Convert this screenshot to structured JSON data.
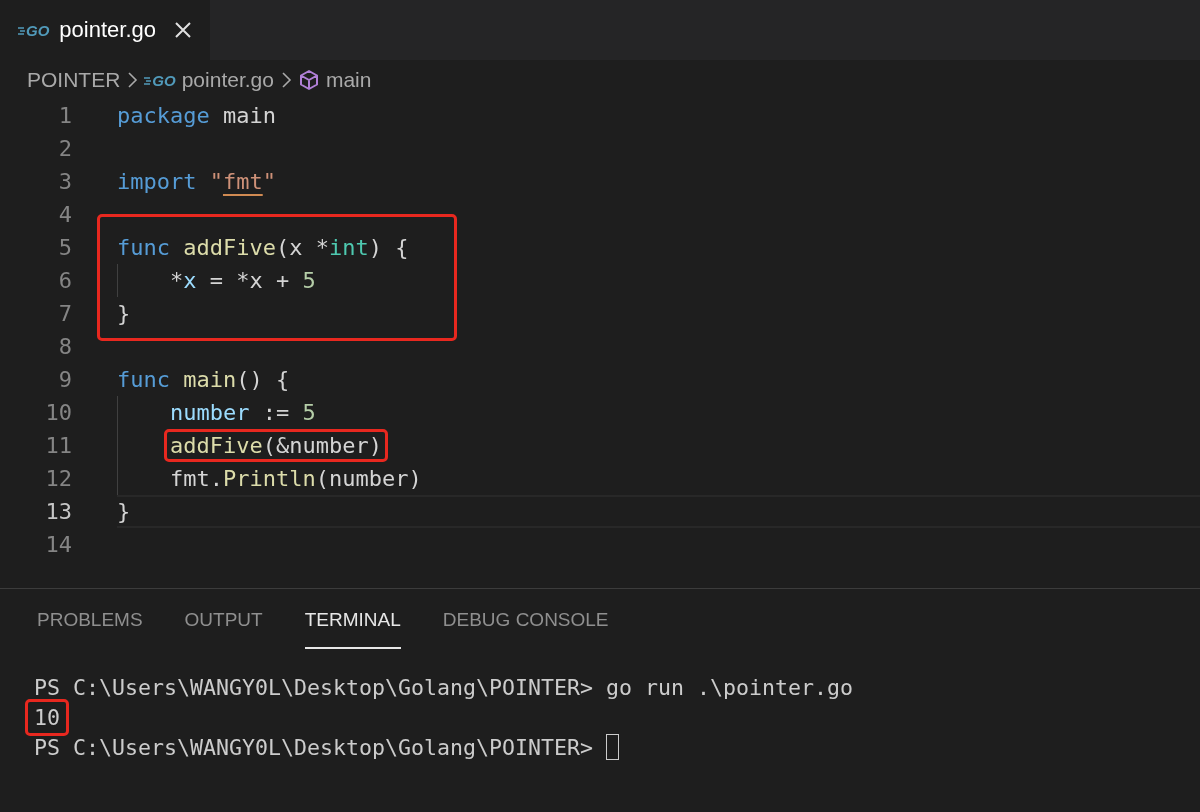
{
  "tabs": [
    {
      "icon_text": "GO",
      "label": "pointer.go",
      "selected": true
    }
  ],
  "breadcrumb": [
    {
      "kind": "folder",
      "label": "POINTER"
    },
    {
      "kind": "file",
      "icon_text": "GO",
      "label": "pointer.go"
    },
    {
      "kind": "symbol",
      "label": "main"
    }
  ],
  "code": [
    {
      "boxed": false,
      "lines": [
        {
          "number": "1",
          "current": false,
          "indented": false,
          "tokens": [
            {
              "kind": "keyword",
              "text": "package"
            },
            {
              "kind": "plain",
              "text": " main"
            }
          ]
        },
        {
          "number": "2",
          "current": false,
          "indented": false
        },
        {
          "number": "3",
          "current": false,
          "indented": false,
          "tokens": [
            {
              "kind": "keyword",
              "text": "import "
            },
            {
              "kind": "string",
              "text": "\""
            },
            {
              "kind": "string_warn",
              "text": "fmt"
            },
            {
              "kind": "string",
              "text": "\""
            }
          ]
        },
        {
          "number": "4",
          "current": false,
          "indented": false
        }
      ]
    },
    {
      "boxed": true,
      "lines": [
        {
          "number": "5",
          "current": false,
          "indented": false,
          "tokens": [
            {
              "kind": "keyword",
              "text": "func "
            },
            {
              "kind": "func",
              "text": "addFive"
            },
            {
              "kind": "plain",
              "text": "(x *"
            },
            {
              "kind": "type",
              "text": "int"
            },
            {
              "kind": "plain",
              "text": ") {"
            }
          ]
        },
        {
          "number": "6",
          "current": false,
          "indented": true,
          "tokens": [
            {
              "kind": "plain",
              "text": "*"
            },
            {
              "kind": "var",
              "text": "x"
            },
            {
              "kind": "plain",
              "text": " = *x + "
            },
            {
              "kind": "number",
              "text": "5"
            }
          ]
        },
        {
          "number": "7",
          "current": false,
          "indented": false,
          "tokens": [
            {
              "kind": "plain",
              "text": "}"
            }
          ]
        }
      ]
    },
    {
      "boxed": false,
      "lines": [
        {
          "number": "8",
          "current": false,
          "indented": false
        },
        {
          "number": "9",
          "current": false,
          "indented": false,
          "tokens": [
            {
              "kind": "keyword",
              "text": "func "
            },
            {
              "kind": "func",
              "text": "main"
            },
            {
              "kind": "plain",
              "text": "() {"
            }
          ]
        },
        {
          "number": "10",
          "current": false,
          "indented": true,
          "tokens": [
            {
              "kind": "var",
              "text": "number"
            },
            {
              "kind": "plain",
              "text": " := "
            },
            {
              "kind": "number",
              "text": "5"
            }
          ]
        },
        {
          "number": "11",
          "current": false,
          "indented": true,
          "tokens": [
            {
              "kind": "box",
              "tokens": [
                {
                  "kind": "func",
                  "text": "addFive"
                },
                {
                  "kind": "plain",
                  "text": "(&number)"
                }
              ]
            }
          ]
        },
        {
          "number": "12",
          "current": false,
          "indented": true,
          "tokens": [
            {
              "kind": "plain",
              "text": "fmt."
            },
            {
              "kind": "func",
              "text": "Println"
            },
            {
              "kind": "plain",
              "text": "(number)"
            }
          ]
        },
        {
          "number": "13",
          "current": true,
          "indented": false,
          "tokens": [
            {
              "kind": "plain",
              "text": "}"
            }
          ]
        },
        {
          "number": "14",
          "current": false,
          "indented": false
        }
      ]
    }
  ],
  "panel_tabs": [
    {
      "label": "PROBLEMS",
      "selected": false
    },
    {
      "label": "OUTPUT",
      "selected": false
    },
    {
      "label": "TERMINAL",
      "selected": true
    },
    {
      "label": "DEBUG CONSOLE",
      "selected": false
    }
  ],
  "terminal": [
    {
      "text": "PS C:\\Users\\WANGY0L\\Desktop\\Golang\\POINTER> go run .\\pointer.go",
      "boxed": false,
      "cursor": false
    },
    {
      "text": "10",
      "boxed": true,
      "cursor": false
    },
    {
      "text": "PS C:\\Users\\WANGY0L\\Desktop\\Golang\\POINTER> ",
      "boxed": false,
      "cursor": true
    }
  ]
}
